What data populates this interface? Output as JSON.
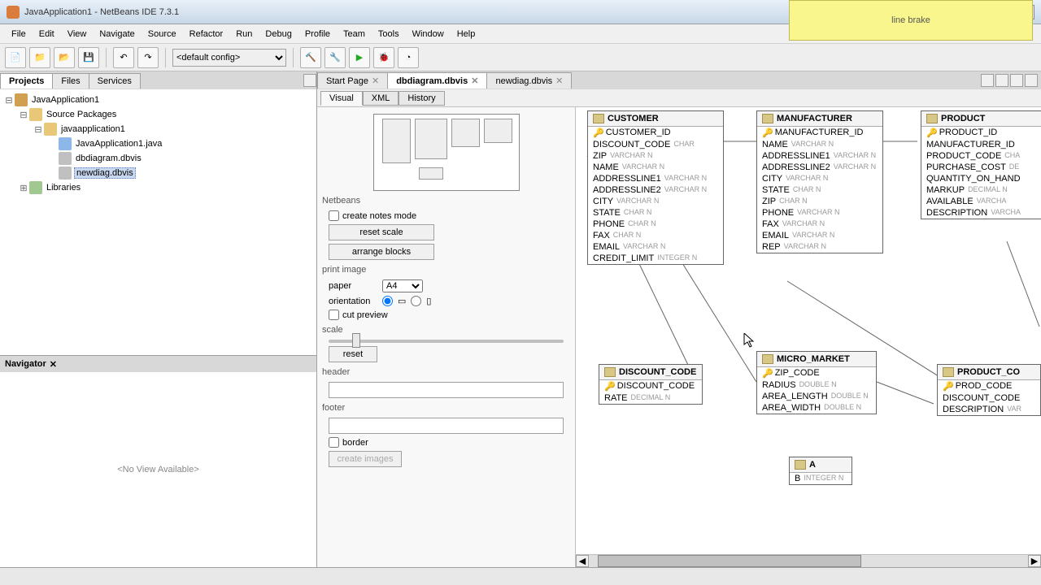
{
  "window": {
    "title": "JavaApplication1 - NetBeans IDE 7.3.1"
  },
  "overlay": {
    "text": "line brake"
  },
  "menu": {
    "items": [
      "File",
      "Edit",
      "View",
      "Navigate",
      "Source",
      "Refactor",
      "Run",
      "Debug",
      "Profile",
      "Team",
      "Tools",
      "Window",
      "Help"
    ]
  },
  "toolbar": {
    "config": "<default config>"
  },
  "left_tabs": {
    "items": [
      "Projects",
      "Files",
      "Services"
    ],
    "active": 0
  },
  "project_tree": {
    "root": "JavaApplication1",
    "src": "Source Packages",
    "pkg": "javaapplication1",
    "files": [
      "JavaApplication1.java",
      "dbdiagram.dbvis",
      "newdiag.dbvis"
    ],
    "selected": 2,
    "libs": "Libraries"
  },
  "navigator": {
    "title": "Navigator",
    "body": "<No View Available>"
  },
  "editor_tabs": {
    "items": [
      "Start Page",
      "dbdiagram.dbvis",
      "newdiag.dbvis"
    ],
    "active": 1
  },
  "sub_tabs": {
    "items": [
      "Visual",
      "XML",
      "History"
    ],
    "active": 0
  },
  "side": {
    "heading": "Netbeans",
    "create_notes": "create notes mode",
    "reset_scale": "reset scale",
    "arrange_blocks": "arrange blocks",
    "print_image": "print image",
    "paper_label": "paper",
    "paper_value": "A4",
    "orientation": "orientation",
    "cut_preview": "cut preview",
    "scale": "scale",
    "reset": "reset",
    "header": "header",
    "footer": "footer",
    "border": "border",
    "create_images": "create images"
  },
  "tables": {
    "customer": {
      "name": "CUSTOMER",
      "cols": [
        {
          "k": true,
          "n": "CUSTOMER_ID",
          "t": ""
        },
        {
          "k": false,
          "n": "DISCOUNT_CODE",
          "t": "CHAR"
        },
        {
          "k": false,
          "n": "ZIP",
          "t": "VARCHAR N"
        },
        {
          "k": false,
          "n": "NAME",
          "t": "VARCHAR N"
        },
        {
          "k": false,
          "n": "ADDRESSLINE1",
          "t": "VARCHAR N"
        },
        {
          "k": false,
          "n": "ADDRESSLINE2",
          "t": "VARCHAR N"
        },
        {
          "k": false,
          "n": "CITY",
          "t": "VARCHAR N"
        },
        {
          "k": false,
          "n": "STATE",
          "t": "CHAR N"
        },
        {
          "k": false,
          "n": "PHONE",
          "t": "CHAR N"
        },
        {
          "k": false,
          "n": "FAX",
          "t": "CHAR N"
        },
        {
          "k": false,
          "n": "EMAIL",
          "t": "VARCHAR N"
        },
        {
          "k": false,
          "n": "CREDIT_LIMIT",
          "t": "INTEGER N"
        }
      ]
    },
    "manufacturer": {
      "name": "MANUFACTURER",
      "cols": [
        {
          "k": true,
          "n": "MANUFACTURER_ID",
          "t": ""
        },
        {
          "k": false,
          "n": "NAME",
          "t": "VARCHAR N"
        },
        {
          "k": false,
          "n": "ADDRESSLINE1",
          "t": "VARCHAR N"
        },
        {
          "k": false,
          "n": "ADDRESSLINE2",
          "t": "VARCHAR N"
        },
        {
          "k": false,
          "n": "CITY",
          "t": "VARCHAR N"
        },
        {
          "k": false,
          "n": "STATE",
          "t": "CHAR N"
        },
        {
          "k": false,
          "n": "ZIP",
          "t": "CHAR N"
        },
        {
          "k": false,
          "n": "PHONE",
          "t": "VARCHAR N"
        },
        {
          "k": false,
          "n": "FAX",
          "t": "VARCHAR N"
        },
        {
          "k": false,
          "n": "EMAIL",
          "t": "VARCHAR N"
        },
        {
          "k": false,
          "n": "REP",
          "t": "VARCHAR N"
        }
      ]
    },
    "product": {
      "name": "PRODUCT",
      "cols": [
        {
          "k": true,
          "n": "PRODUCT_ID",
          "t": ""
        },
        {
          "k": false,
          "n": "MANUFACTURER_ID",
          "t": ""
        },
        {
          "k": false,
          "n": "PRODUCT_CODE",
          "t": "CHA"
        },
        {
          "k": false,
          "n": "PURCHASE_COST",
          "t": "DE"
        },
        {
          "k": false,
          "n": "QUANTITY_ON_HAND",
          "t": ""
        },
        {
          "k": false,
          "n": "MARKUP",
          "t": "DECIMAL N"
        },
        {
          "k": false,
          "n": "AVAILABLE",
          "t": "VARCHA"
        },
        {
          "k": false,
          "n": "DESCRIPTION",
          "t": "VARCHA"
        }
      ]
    },
    "discount_code": {
      "name": "DISCOUNT_CODE",
      "cols": [
        {
          "k": true,
          "n": "DISCOUNT_CODE",
          "t": ""
        },
        {
          "k": false,
          "n": "RATE",
          "t": "DECIMAL N"
        }
      ]
    },
    "micro_market": {
      "name": "MICRO_MARKET",
      "cols": [
        {
          "k": true,
          "n": "ZIP_CODE",
          "t": ""
        },
        {
          "k": false,
          "n": "RADIUS",
          "t": "DOUBLE N"
        },
        {
          "k": false,
          "n": "AREA_LENGTH",
          "t": "DOUBLE N"
        },
        {
          "k": false,
          "n": "AREA_WIDTH",
          "t": "DOUBLE N"
        }
      ]
    },
    "product_co": {
      "name": "PRODUCT_CO",
      "cols": [
        {
          "k": true,
          "n": "PROD_CODE",
          "t": ""
        },
        {
          "k": false,
          "n": "DISCOUNT_CODE",
          "t": ""
        },
        {
          "k": false,
          "n": "DESCRIPTION",
          "t": "VAR"
        }
      ]
    },
    "a": {
      "name": "A",
      "cols": [
        {
          "k": false,
          "n": "B",
          "t": "INTEGER N"
        }
      ]
    }
  }
}
